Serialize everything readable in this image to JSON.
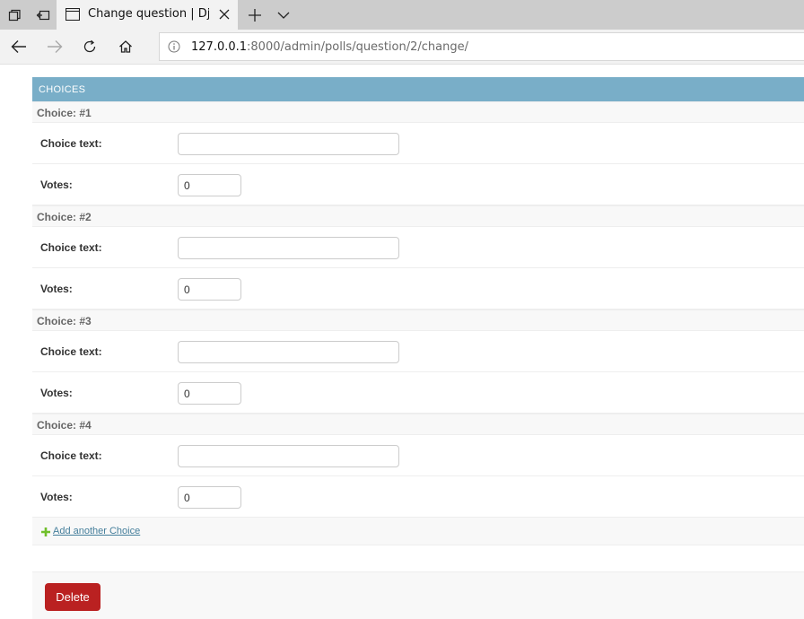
{
  "browser": {
    "tab": {
      "title": "Change question | Django"
    },
    "address": {
      "host": "127.0.0.1",
      "path": ":8000/admin/polls/question/2/change/"
    }
  },
  "inline": {
    "caption": "CHOICES",
    "items": [
      {
        "heading": "Choice: #1",
        "text_label": "Choice text:",
        "text_value": "",
        "votes_label": "Votes:",
        "votes_value": "0"
      },
      {
        "heading": "Choice: #2",
        "text_label": "Choice text:",
        "text_value": "",
        "votes_label": "Votes:",
        "votes_value": "0"
      },
      {
        "heading": "Choice: #3",
        "text_label": "Choice text:",
        "text_value": "",
        "votes_label": "Votes:",
        "votes_value": "0"
      },
      {
        "heading": "Choice: #4",
        "text_label": "Choice text:",
        "text_value": "",
        "votes_label": "Votes:",
        "votes_value": "0"
      }
    ],
    "add_label": "Add another Choice"
  },
  "submit": {
    "delete_label": "Delete"
  },
  "colors": {
    "header": "#79aec8",
    "delete": "#ba2121",
    "link": "#447e9b",
    "add_icon": "#70bf2b"
  }
}
